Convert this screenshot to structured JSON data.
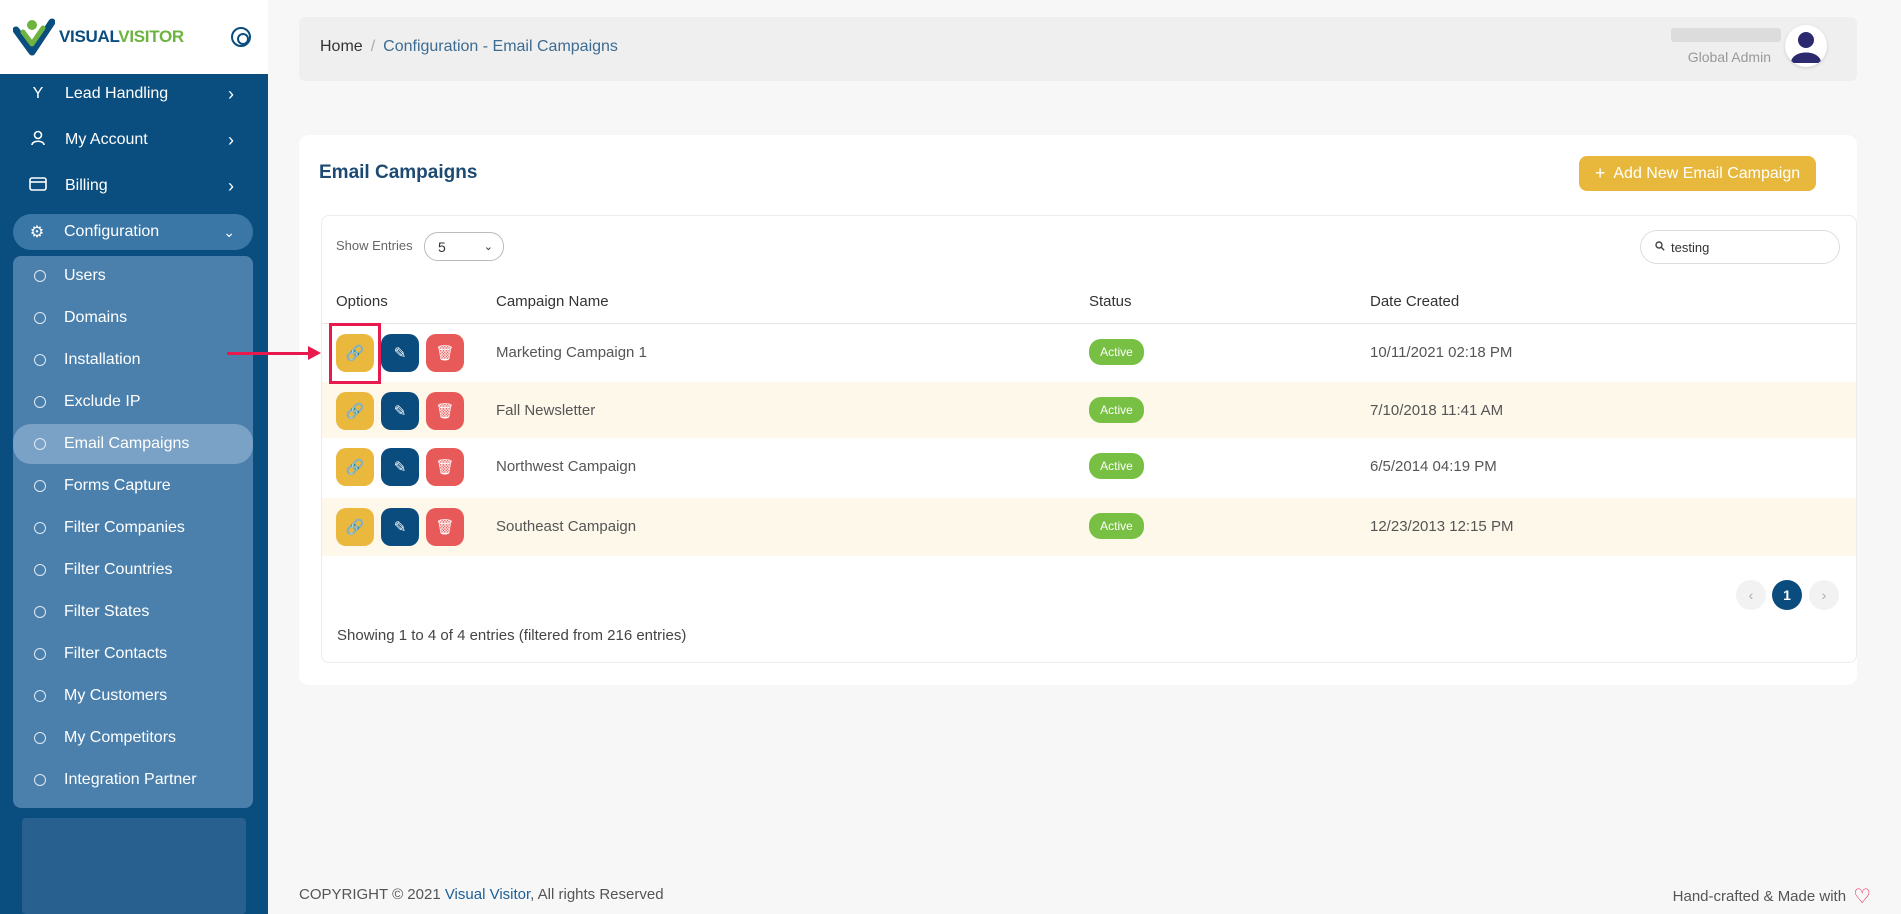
{
  "brand": {
    "name_part1": "VISUAL",
    "name_part2": "VISITOR"
  },
  "sidebar": {
    "menu": [
      {
        "label": "Lead Handling",
        "icon": "filter-icon"
      },
      {
        "label": "My Account",
        "icon": "user-icon"
      },
      {
        "label": "Billing",
        "icon": "card-icon"
      },
      {
        "label": "Configuration",
        "icon": "gear-icon"
      }
    ],
    "submenu": [
      "Users",
      "Domains",
      "Installation",
      "Exclude IP",
      "Email Campaigns",
      "Forms Capture",
      "Filter Companies",
      "Filter Countries",
      "Filter States",
      "Filter Contacts",
      "My Customers",
      "My Competitors",
      "Integration Partner"
    ],
    "active_submenu": "Email Campaigns"
  },
  "header": {
    "breadcrumb_home": "Home",
    "breadcrumb_current": "Configuration - Email Campaigns",
    "user_role": "Global Admin"
  },
  "card": {
    "title": "Email Campaigns",
    "add_button": "Add New Email Campaign",
    "show_entries_label": "Show Entries",
    "show_entries_value": "5",
    "search_value": "testing"
  },
  "table": {
    "headers": {
      "options": "Options",
      "name": "Campaign Name",
      "status": "Status",
      "date": "Date Created"
    },
    "rows": [
      {
        "name": "Marketing Campaign 1",
        "status": "Active",
        "date": "10/11/2021 02:18 PM"
      },
      {
        "name": "Fall Newsletter",
        "status": "Active",
        "date": "7/10/2018 11:41 AM"
      },
      {
        "name": "Northwest Campaign",
        "status": "Active",
        "date": "6/5/2014 04:19 PM"
      },
      {
        "name": "Southeast Campaign",
        "status": "Active",
        "date": "12/23/2013 12:15 PM"
      }
    ]
  },
  "pagination": {
    "current_page": "1",
    "info": "Showing 1 to 4 of 4 entries (filtered from 216 entries)"
  },
  "footer": {
    "copyright_prefix": "COPYRIGHT © 2021 ",
    "copyright_brand": "Visual Visitor",
    "copyright_suffix": ", All rights Reserved",
    "right_text": "Hand-crafted & Made with"
  },
  "colors": {
    "sidebar_bg": "#0a4d7f",
    "accent_yellow": "#e8b83d",
    "edit_blue": "#0b4c7e",
    "delete_red": "#e85a5a",
    "status_green": "#77c043",
    "annotation_red": "#e8194c"
  }
}
